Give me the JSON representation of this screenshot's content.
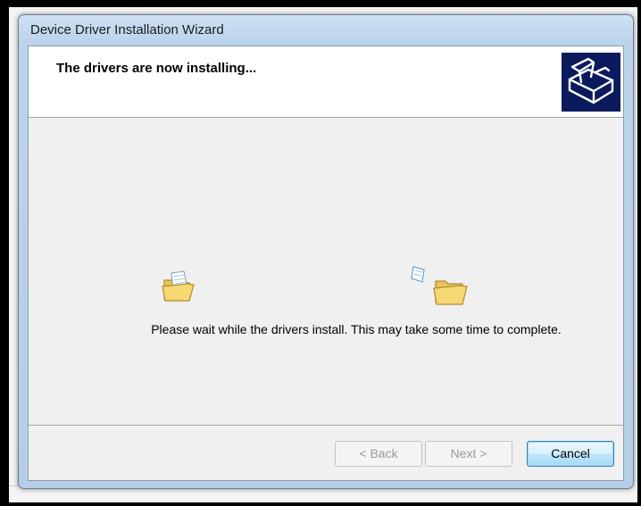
{
  "window": {
    "title": "Device Driver Installation Wizard"
  },
  "header": {
    "heading": "The drivers are now installing...",
    "icon": "wizard-box-icon"
  },
  "body": {
    "message": "Please wait while the drivers install. This may take some time to complete.",
    "animation_icons": [
      "open-folder-icon",
      "flying-document-icon",
      "folder-icon"
    ]
  },
  "buttons": {
    "back": "< Back",
    "next": "Next >",
    "cancel": "Cancel"
  },
  "colors": {
    "title_bar": "#bcd3ec",
    "client_bg": "#f0f0f0",
    "header_bg": "#ffffff",
    "icon_bg": "#0b1a5c",
    "default_button_border": "#3c7fb1"
  }
}
